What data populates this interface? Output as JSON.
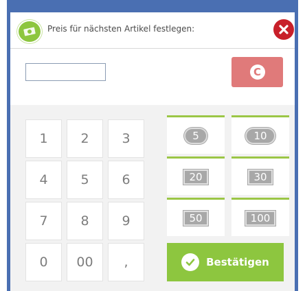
{
  "dialog": {
    "title": "Preis für nächsten Artikel festlegen:",
    "title_icon": "money-icon",
    "close_icon": "close-icon"
  },
  "display": {
    "amount_value": "",
    "clear_label": "C"
  },
  "keypad": {
    "keys": [
      "1",
      "2",
      "3",
      "4",
      "5",
      "6",
      "7",
      "8",
      "9",
      "0",
      "00",
      ","
    ]
  },
  "money": {
    "buttons": [
      {
        "label": "5",
        "kind": "coin"
      },
      {
        "label": "10",
        "kind": "coin"
      },
      {
        "label": "20",
        "kind": "note"
      },
      {
        "label": "30",
        "kind": "note-stack"
      },
      {
        "label": "50",
        "kind": "note"
      },
      {
        "label": "100",
        "kind": "note"
      }
    ]
  },
  "confirm": {
    "label": "Bestätigen"
  },
  "colors": {
    "frame": "#4a6fb2",
    "accent_green": "#8dc63f",
    "clear_red": "#e07a7a",
    "close_red": "#c8202a"
  }
}
